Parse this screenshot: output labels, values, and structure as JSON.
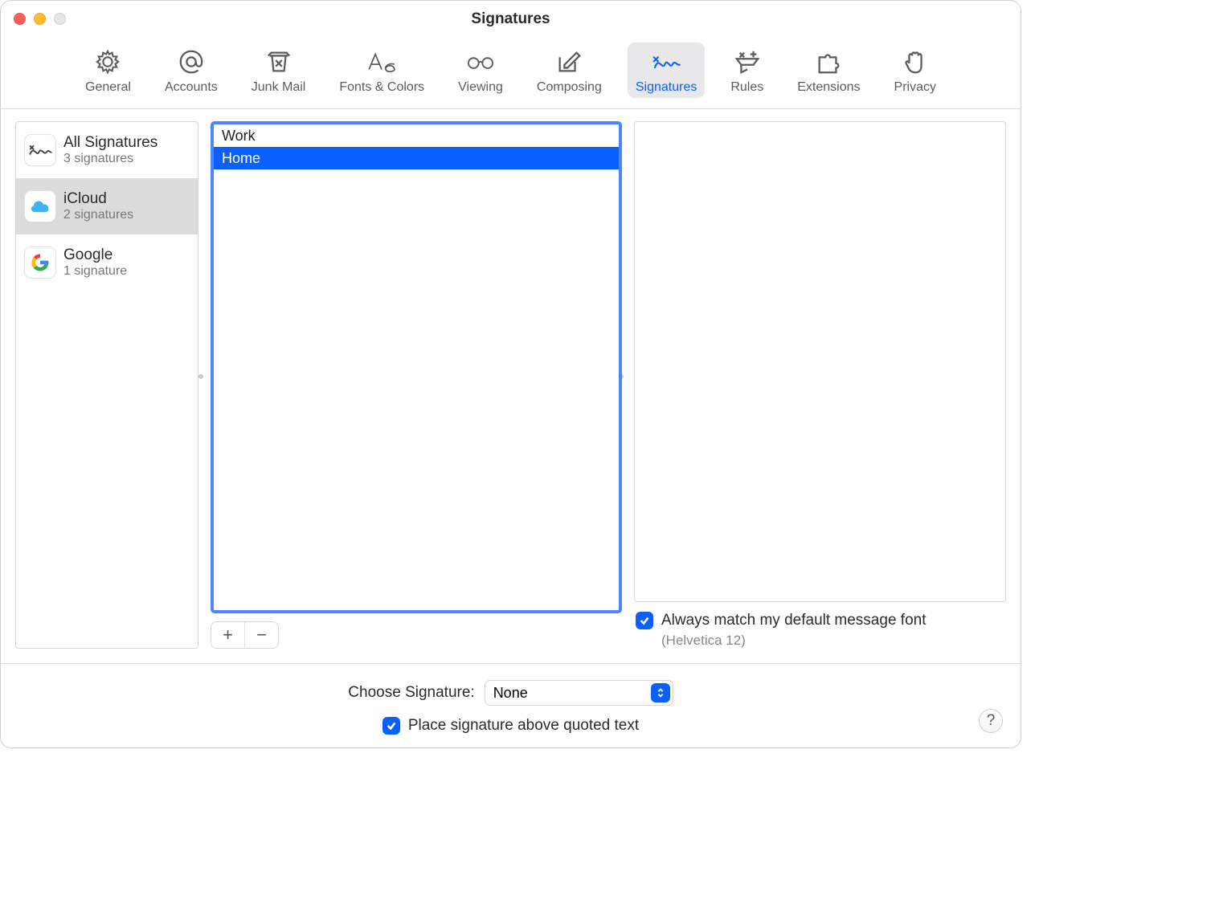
{
  "window": {
    "title": "Signatures"
  },
  "toolbar": {
    "items": [
      {
        "label": "General"
      },
      {
        "label": "Accounts"
      },
      {
        "label": "Junk Mail"
      },
      {
        "label": "Fonts & Colors"
      },
      {
        "label": "Viewing"
      },
      {
        "label": "Composing"
      },
      {
        "label": "Signatures"
      },
      {
        "label": "Rules"
      },
      {
        "label": "Extensions"
      },
      {
        "label": "Privacy"
      }
    ],
    "active_index": 6
  },
  "accounts": [
    {
      "name": "All Signatures",
      "count": "3 signatures"
    },
    {
      "name": "iCloud",
      "count": "2 signatures"
    },
    {
      "name": "Google",
      "count": "1 signature"
    }
  ],
  "accounts_selected_index": 1,
  "signatures": [
    {
      "name": "Work"
    },
    {
      "name": "Home"
    }
  ],
  "signatures_selected_index": 1,
  "match_font": {
    "label": "Always match my default message font",
    "hint": "(Helvetica 12)",
    "checked": true
  },
  "choose": {
    "label": "Choose Signature:",
    "value": "None"
  },
  "place_above": {
    "label": "Place signature above quoted text",
    "checked": true
  },
  "buttons": {
    "add": "+",
    "remove": "−"
  },
  "help": "?"
}
